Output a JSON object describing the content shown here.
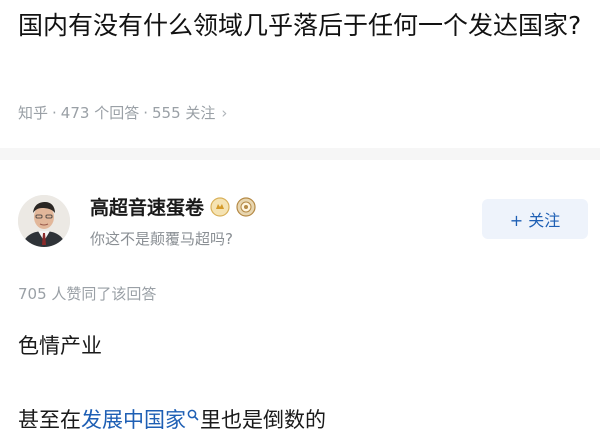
{
  "question": {
    "title": "国内有没有什么领域几乎落后于任何一个发达国家?",
    "source": "知乎",
    "answers_count": "473 个回答",
    "followers_count": "555 关注",
    "separator": "·",
    "chevron": "›"
  },
  "answer": {
    "author_name": "高超音速蛋卷",
    "author_bio": "你这不是颠覆马超吗?",
    "follow_label": "+ 关注",
    "agree_text": "705 人赞同了该回答",
    "paragraph_1": "色情产业",
    "paragraph_2_before": "甚至在",
    "paragraph_2_link": "发展中国家",
    "paragraph_2_after": "里也是倒数的"
  },
  "colors": {
    "link": "#1e5fb4",
    "meta": "#9aa0a6",
    "follow_bg": "#eef3fb"
  }
}
